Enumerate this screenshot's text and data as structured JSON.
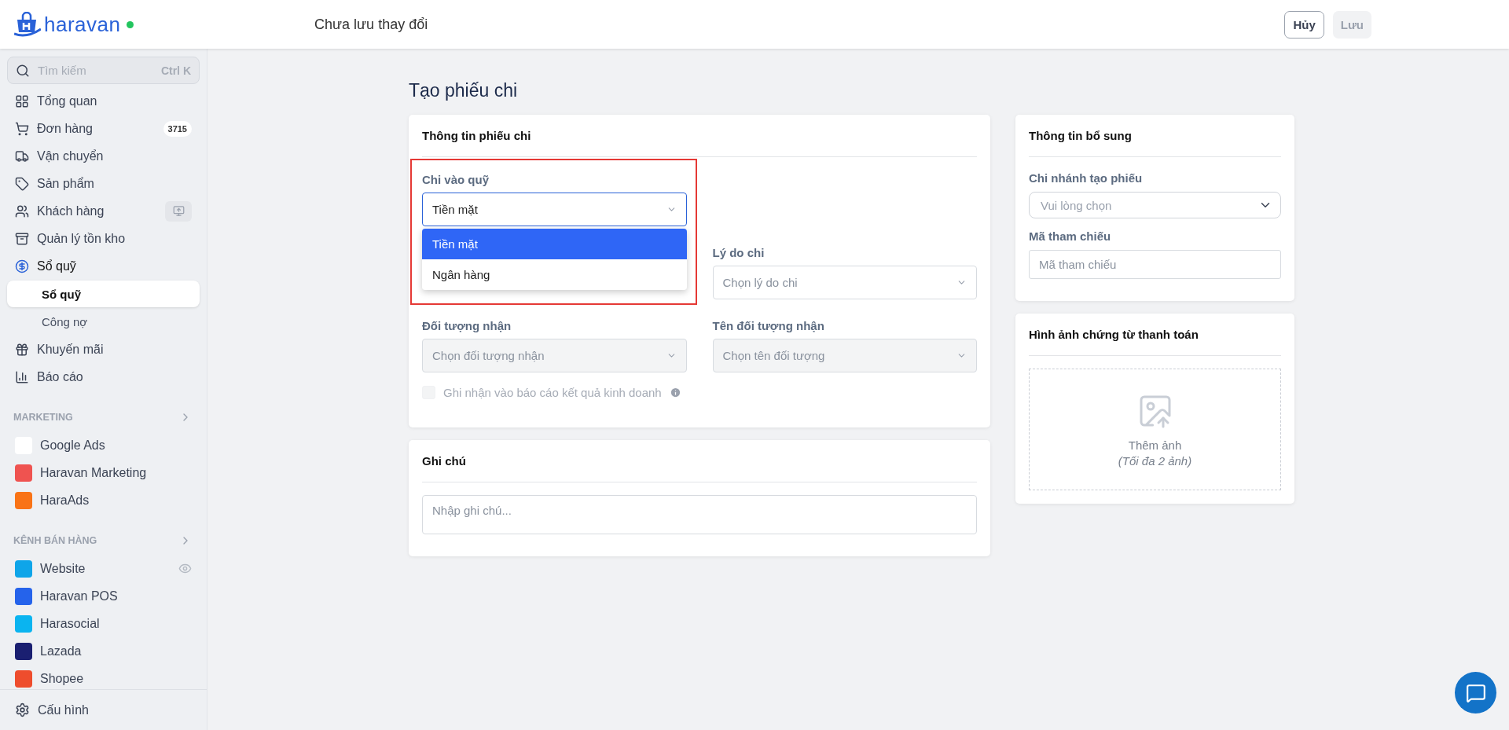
{
  "topbar": {
    "logo": "haravan",
    "online": true,
    "status": "Chưa lưu thay đổi",
    "buttons": [
      {
        "label": "Hủy",
        "disabled": false
      },
      {
        "label": "Lưu",
        "disabled": true
      }
    ]
  },
  "sidebar": {
    "search": {
      "placeholder": "Tìm kiếm",
      "shortcut": "Ctrl K"
    },
    "items": [
      {
        "label": "Tổng quan",
        "expanded": false
      },
      {
        "label": "Đơn hàng",
        "badge": "3715",
        "expanded": false
      },
      {
        "label": "Vận chuyển",
        "expanded": false
      },
      {
        "label": "Sản phẩm",
        "expanded": false
      },
      {
        "label": "Khách hàng",
        "expanded": false
      },
      {
        "label": "Quản lý tồn kho",
        "expanded": false
      },
      {
        "label": "Sổ quỹ",
        "expanded": true,
        "children": [
          {
            "label": "Sổ quỹ",
            "selected": true
          },
          {
            "label": "Công nợ",
            "selected": false
          }
        ]
      },
      {
        "label": "Khuyến mãi",
        "expanded": false
      },
      {
        "label": "Báo cáo",
        "expanded": false
      }
    ],
    "sections": [
      {
        "title": "MARKETING",
        "items": [
          "Google Ads",
          "Haravan Marketing",
          "HaraAds"
        ]
      },
      {
        "title": "KÊNH BÁN HÀNG",
        "items": [
          "Website",
          "Haravan POS",
          "Harasocial",
          "Lazada",
          "Shopee"
        ]
      }
    ],
    "footer": "Cấu hình"
  },
  "page": {
    "title": "Tạo phiếu chi",
    "main_card": {
      "title": "Thông tin phiếu chi",
      "fields": [
        {
          "label": "Chi vào quỹ",
          "value": "Tiền mặt",
          "disabled": false,
          "focused": true,
          "highlighted": true,
          "options": [
            {
              "label": "Tiền mặt",
              "selected": true
            },
            {
              "label": "Ngân hàng",
              "selected": false
            }
          ]
        },
        {
          "label": "Lý do chi",
          "placeholder": "Chọn lý do chi",
          "disabled": false,
          "focused": false
        },
        {
          "label": "Đối tượng nhận",
          "placeholder": "Chọn đối tượng nhận",
          "disabled": true,
          "focused": false
        },
        {
          "label": "Tên đối tượng nhận",
          "placeholder": "Chọn tên đối tượng",
          "disabled": true,
          "focused": false
        }
      ],
      "checkbox": {
        "label": "Ghi nhận vào báo cáo kết quả kinh doanh",
        "checked": false,
        "disabled": true
      }
    },
    "note_card": {
      "title": "Ghi chú",
      "placeholder": "Nhập ghi chú..."
    },
    "extra_card": {
      "title": "Thông tin bổ sung",
      "branch": {
        "label": "Chi nhánh tạo phiếu",
        "placeholder": "Vui lòng chọn"
      },
      "reference": {
        "label": "Mã tham chiếu",
        "placeholder": "Mã tham chiếu"
      }
    },
    "image_card": {
      "title": "Hình ảnh chứng từ thanh toán",
      "action": "Thêm ảnh",
      "hint": "(Tối đa 2 ảnh)"
    }
  }
}
